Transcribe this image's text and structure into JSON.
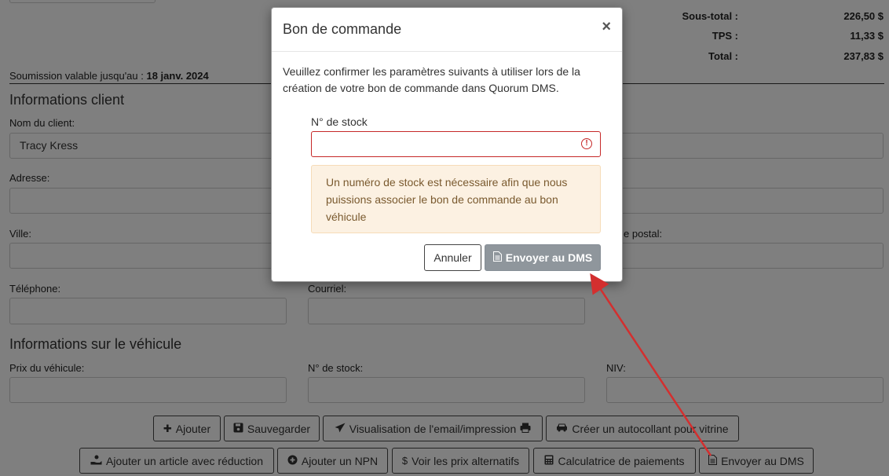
{
  "totals": [
    {
      "label": "Sous-total :",
      "value": "226,50 $"
    },
    {
      "label": "TPS :",
      "value": "11,33 $"
    },
    {
      "label": "Total :",
      "value": "237,83 $"
    }
  ],
  "validity": {
    "prefix": "Soumission valable jusqu'au : ",
    "date": "18 janv. 2024"
  },
  "client": {
    "title": "Informations client",
    "name_label": "Nom du client:",
    "name_value": "Tracy Kress",
    "address_label": "Adresse:",
    "city_label": "Ville:",
    "postal_label": "e postal:",
    "phone_label": "Téléphone:",
    "email_label": "Courriel:"
  },
  "vehicle": {
    "title": "Informations sur le véhicule",
    "price_label": "Prix du véhicule:",
    "stock_label": "N° de stock:",
    "vin_label": "NIV:"
  },
  "actions": {
    "add": "Ajouter",
    "save": "Sauvegarder",
    "preview": "Visualisation de l'email/impression",
    "sticker": "Créer un autocollant pour vitrine",
    "add_discount": "Ajouter un article avec réduction",
    "add_npn": "Ajouter un NPN",
    "alt_prices": "Voir les prix alternatifs",
    "calculator": "Calculatrice de paiements",
    "send_dms": "Envoyer au DMS"
  },
  "modal": {
    "title": "Bon de commande",
    "close": "×",
    "text": "Veuillez confirmer les paramètres suivants à utiliser lors de la création de votre bon de commande dans Quorum DMS.",
    "stock_label": "N° de stock",
    "stock_value": "",
    "warning": "Un numéro de stock est nécessaire afin que nous puissions associer le bon de commande au bon véhicule",
    "cancel": "Annuler",
    "send": "Envoyer au DMS"
  },
  "colors": {
    "error": "#c62828",
    "warning_bg": "#fcf1e2",
    "send_disabled": "#8f969c",
    "arrow": "#d32f2f"
  }
}
